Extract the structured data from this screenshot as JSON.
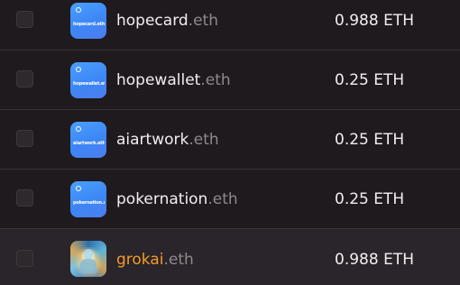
{
  "domains": [
    {
      "name": "hopecard",
      "tld": ".eth",
      "price": "0.988 ETH",
      "avatar_type": "blue",
      "avatar_text": "hopecard.eth",
      "highlighted": false,
      "accent": false
    },
    {
      "name": "hopewallet",
      "tld": ".eth",
      "price": "0.25 ETH",
      "avatar_type": "blue",
      "avatar_text": "hopewallet.eth",
      "highlighted": false,
      "accent": false
    },
    {
      "name": "aiartwork",
      "tld": ".eth",
      "price": "0.25 ETH",
      "avatar_type": "blue",
      "avatar_text": "aiartwork.eth",
      "highlighted": false,
      "accent": false
    },
    {
      "name": "pokernation",
      "tld": ".eth",
      "price": "0.25 ETH",
      "avatar_type": "blue",
      "avatar_text": "pokernation.eth",
      "highlighted": false,
      "accent": false
    },
    {
      "name": "grokai",
      "tld": ".eth",
      "price": "0.988 ETH",
      "avatar_type": "art",
      "avatar_text": "",
      "highlighted": true,
      "accent": true
    }
  ],
  "colors": {
    "background": "#1f1a1d",
    "row_highlight": "#29252a",
    "accent_orange": "#f59a2b",
    "tld_gray": "#8f898d",
    "avatar_blue": "#3d86f5"
  }
}
